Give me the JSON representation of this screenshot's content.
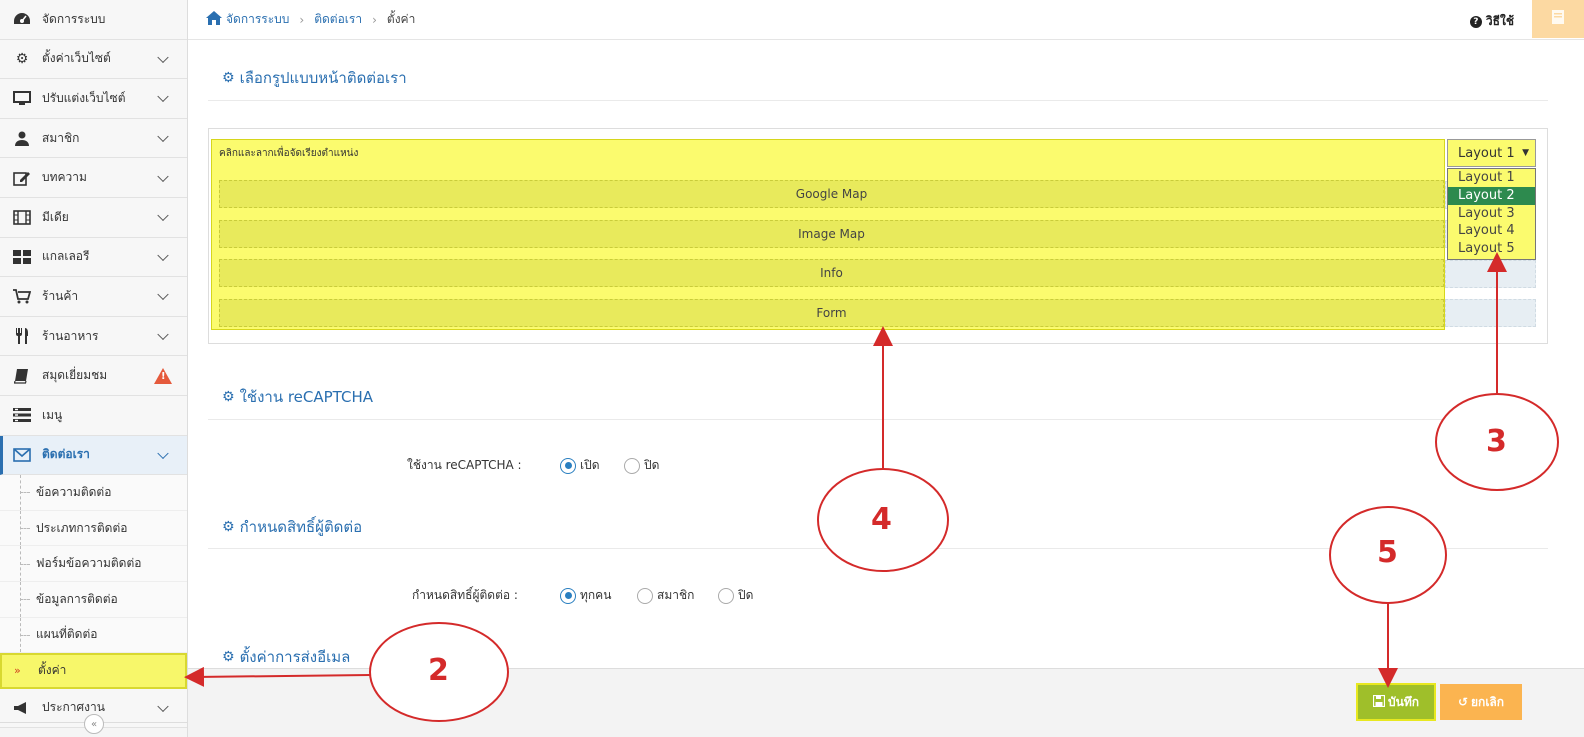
{
  "sidebar": {
    "items": [
      {
        "label": "จัดการระบบ",
        "icon": "dashboard-icon",
        "chevron": false
      },
      {
        "label": "ตั้งค่าเว็บไซต์",
        "icon": "gear-icon",
        "chevron": true
      },
      {
        "label": "ปรับแต่งเว็บไซต์",
        "icon": "monitor-icon",
        "chevron": true
      },
      {
        "label": "สมาชิก",
        "icon": "user-icon",
        "chevron": true
      },
      {
        "label": "บทความ",
        "icon": "edit-icon",
        "chevron": true
      },
      {
        "label": "มีเดีย",
        "icon": "film-icon",
        "chevron": true
      },
      {
        "label": "แกลเลอรี",
        "icon": "grid-icon",
        "chevron": true
      },
      {
        "label": "ร้านค้า",
        "icon": "cart-icon",
        "chevron": true
      },
      {
        "label": "ร้านอาหาร",
        "icon": "utensils-icon",
        "chevron": true
      },
      {
        "label": "สมุดเยี่ยมชม",
        "icon": "book-icon",
        "chevron": false
      },
      {
        "label": "เมนู",
        "icon": "menu-icon",
        "chevron": false
      },
      {
        "label": "ติดต่อเรา",
        "icon": "envelope-icon",
        "chevron": true
      }
    ],
    "subitems": [
      {
        "label": "ข้อความติดต่อ"
      },
      {
        "label": "ประเภทการติดต่อ"
      },
      {
        "label": "ฟอร์มข้อความติดต่อ"
      },
      {
        "label": "ข้อมูลการติดต่อ"
      },
      {
        "label": "แผนที่ติดต่อ"
      },
      {
        "label": "ตั้งค่า"
      }
    ],
    "after_item": {
      "label": "ประกาศงาน"
    }
  },
  "topbar": {
    "breadcrumb": [
      "จัดการระบบ",
      "ติดต่อเรา",
      "ตั้งค่า"
    ],
    "help_label": "วิธีใช้"
  },
  "layout_section": {
    "title": "เลือกรูปแบบหน้าติดต่อเรา",
    "drag_hint": "คลิกและลากเพื่อจัดเรียงตำแหน่ง",
    "rows": [
      "Google Map",
      "Image Map",
      "Info",
      "Form"
    ],
    "select_value": "Layout 1",
    "options": [
      "Layout 1",
      "Layout 2",
      "Layout 3",
      "Layout 4",
      "Layout 5"
    ]
  },
  "recaptcha_section": {
    "title": "ใช้งาน reCAPTCHA",
    "label": "ใช้งาน reCAPTCHA :",
    "options": [
      "เปิด",
      "ปิด"
    ]
  },
  "permission_section": {
    "title": "กำหนดสิทธิ์ผู้ติดต่อ",
    "label": "กำหนดสิทธิ์ผู้ติดต่อ :",
    "options": [
      "ทุกคน",
      "สมาชิก",
      "ปิด"
    ]
  },
  "email_section": {
    "title": "ตั้งค่าการส่งอีเมล"
  },
  "footer": {
    "save_label": "บันทึก",
    "cancel_label": "ยกเลิก"
  },
  "annotations": [
    "2",
    "3",
    "4",
    "5"
  ],
  "colors": {
    "accent": "#2a6fb0",
    "highlight": "#fbfb6e",
    "annotation": "#d42a2a",
    "save": "#9fbf2a",
    "cancel": "#fbb450"
  }
}
